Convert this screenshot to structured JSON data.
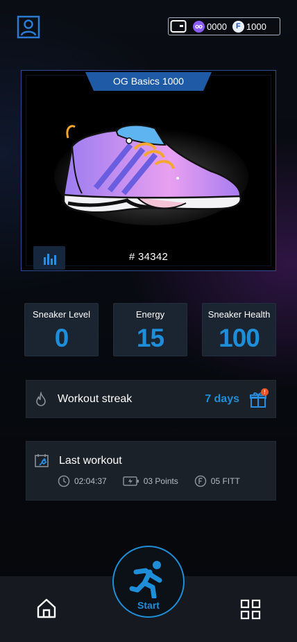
{
  "header": {
    "profile_icon": "profile-icon",
    "wallet_icon": "wallet-icon",
    "tokens": [
      {
        "icon": "purple-token-icon",
        "symbol": "",
        "amount": "0000",
        "color": "#8b5cf6"
      },
      {
        "icon": "f-token-icon",
        "symbol": "F",
        "amount": "1000",
        "color": "#1f4ea8"
      }
    ]
  },
  "sneaker": {
    "name": "OG Basics 1000",
    "token_id": "# 34342",
    "stats_icon": "bar-chart-icon"
  },
  "stats": [
    {
      "label": "Sneaker Level",
      "value": "0"
    },
    {
      "label": "Energy",
      "value": "15"
    },
    {
      "label": "Sneaker Health",
      "value": "100"
    }
  ],
  "streak": {
    "label": "Workout streak",
    "value": "7 days",
    "icon": "flame-icon",
    "reward_icon": "gift-icon",
    "badge": "!"
  },
  "last_workout": {
    "title": "Last workout",
    "icon": "calendar-runner-icon",
    "duration": "02:04:37",
    "points": "03 Points",
    "fitt": "05 FITT"
  },
  "nav": {
    "home_icon": "home-icon",
    "start_label": "Start",
    "grid_icon": "grid-icon"
  },
  "colors": {
    "accent": "#1e8ed8",
    "card_border": "#2f4b94",
    "panel": "#1b2129"
  }
}
